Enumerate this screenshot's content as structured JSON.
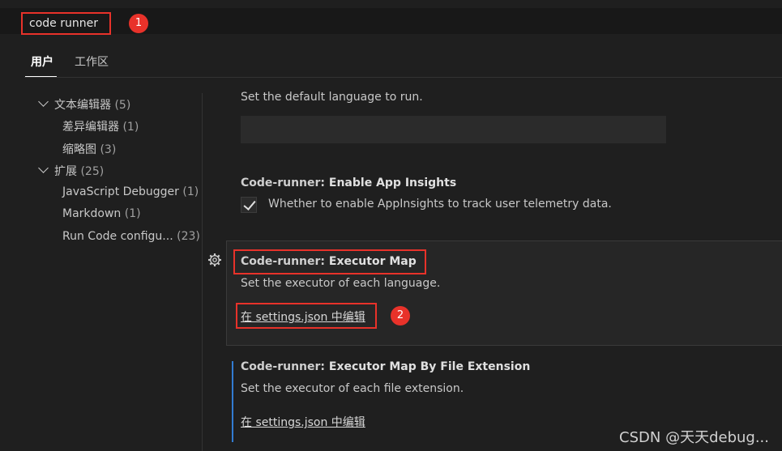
{
  "search": {
    "value": "code runner",
    "badge": "1"
  },
  "tabs": [
    {
      "label": "用户"
    },
    {
      "label": "工作区"
    }
  ],
  "toc": {
    "groups": [
      {
        "label": "文本编辑器",
        "count": "(5)",
        "children": [
          {
            "label": "差异编辑器",
            "count": "(1)"
          },
          {
            "label": "缩略图",
            "count": "(3)"
          }
        ]
      },
      {
        "label": "扩展",
        "count": "(25)",
        "children": [
          {
            "label": "JavaScript Debugger",
            "count": "(1)"
          },
          {
            "label": "Markdown",
            "count": "(1)"
          },
          {
            "label": "Run Code configu...",
            "count": "(23)"
          }
        ]
      }
    ]
  },
  "settings": {
    "default_language": {
      "description": "Set the default language to run."
    },
    "app_insights": {
      "category": "Code-runner: ",
      "name": "Enable App Insights",
      "description": "Whether to enable AppInsights to track user telemetry data.",
      "checked": true
    },
    "executor_map": {
      "category": "Code-runner: ",
      "name": "Executor Map",
      "description": "Set the executor of each language.",
      "link": "在 settings.json 中编辑",
      "badge": "2"
    },
    "executor_map_ext": {
      "category": "Code-runner: ",
      "name": "Executor Map By File Extension",
      "description": "Set the executor of each file extension.",
      "link": "在 settings.json 中编辑"
    }
  },
  "watermark": "CSDN @天天debug...",
  "colors": {
    "highlight": "#e8322a",
    "modified": "#3794ff",
    "background": "#1f1f1f"
  }
}
